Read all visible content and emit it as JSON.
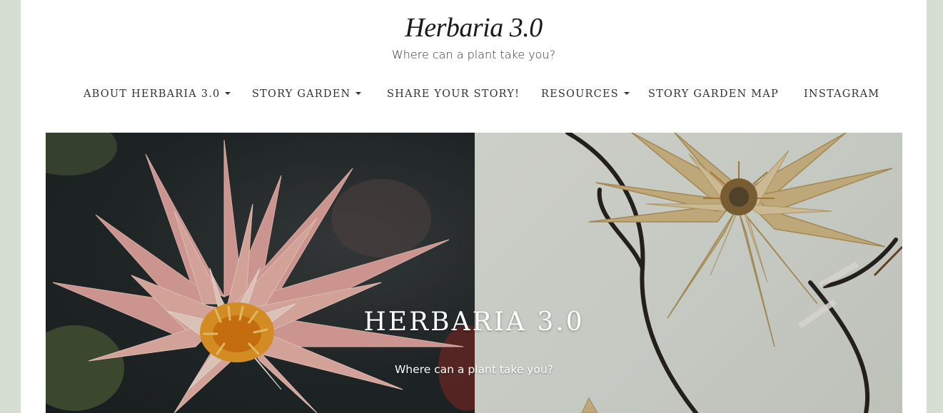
{
  "site": {
    "title": "Herbaria 3.0",
    "tagline": "Where can a plant take you?"
  },
  "nav": {
    "items": [
      {
        "label": "ABOUT HERBARIA 3.0",
        "has_dropdown": true
      },
      {
        "label": "STORY GARDEN",
        "has_dropdown": true
      },
      {
        "label": "SHARE YOUR STORY!",
        "has_dropdown": false
      },
      {
        "label": "RESOURCES",
        "has_dropdown": true
      },
      {
        "label": "STORY GARDEN MAP",
        "has_dropdown": false
      },
      {
        "label": "INSTAGRAM",
        "has_dropdown": false
      }
    ]
  },
  "hero": {
    "title": "HERBARIA 3.0",
    "subtitle": "Where can a plant take you?",
    "left_image": "pink-water-lily-photo",
    "right_image": "pressed-water-lily-herbarium-specimen"
  },
  "colors": {
    "background": "#d6ded4",
    "page": "#ffffff",
    "text": "#333333",
    "hero_text": "#ffffff"
  }
}
